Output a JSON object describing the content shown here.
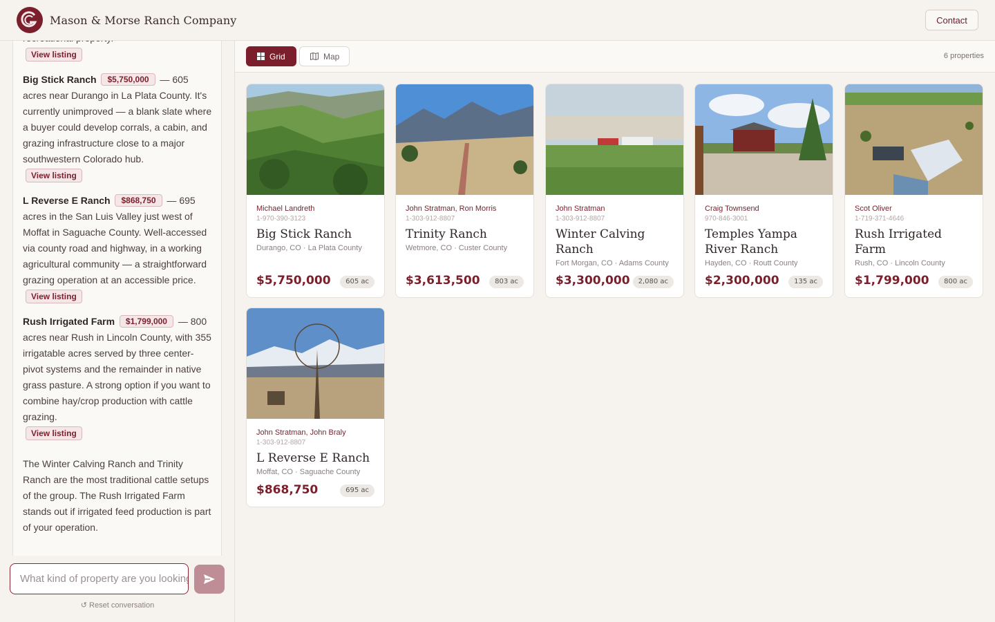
{
  "header": {
    "brand": "Mason & Morse Ranch Company",
    "contact_label": "Contact"
  },
  "chat": {
    "intro_tail": "recreational property.",
    "listings": [
      {
        "name": "Big Stick Ranch",
        "price": "$5,750,000",
        "text": " — 605 acres near Durango in La Plata County. It's currently unimproved — a blank slate where a buyer could develop corrals, a cabin, and grazing infrastructure close to a major southwestern Colorado hub."
      },
      {
        "name": "L Reverse E Ranch",
        "price": "$868,750",
        "text": " — 695 acres in the San Luis Valley just west of Moffat in Saguache County. Well-accessed via county road and highway, in a working agricultural community — a straightforward grazing operation at an accessible price."
      },
      {
        "name": "Rush Irrigated Farm",
        "price": "$1,799,000",
        "text": " — 800 acres near Rush in Lincoln County, with 355 irrigatable acres served by three center-pivot systems and the remainder in native grass pasture. A strong option if you want to combine hay/crop production with cattle grazing."
      }
    ],
    "view_listing_label": "View listing",
    "closing": "The Winter Calving Ranch and Trinity Ranch are the most traditional cattle setups of the group. The Rush Irrigated Farm stands out if irrigated feed production is part of your operation.",
    "input_placeholder": "What kind of property are you looking for?",
    "reset_label": "↺ Reset conversation"
  },
  "toolbar": {
    "grid_label": "Grid",
    "map_label": "Map",
    "count": "6 properties"
  },
  "properties": [
    {
      "agents": "Michael Landreth",
      "phone": "1-970-390-3123",
      "title": "Big Stick Ranch",
      "location": "Durango, CO · La Plata County",
      "price": "$5,750,000",
      "acres": "605 ac"
    },
    {
      "agents": "John Stratman, Ron Morris",
      "phone": "1-303-912-8807",
      "title": "Trinity Ranch",
      "location": "Wetmore, CO · Custer County",
      "price": "$3,613,500",
      "acres": "803 ac"
    },
    {
      "agents": "John Stratman",
      "phone": "1-303-912-8807",
      "title": "Winter Calving Ranch",
      "location": "Fort Morgan, CO · Adams County",
      "price": "$3,300,000",
      "acres": "2,080 ac"
    },
    {
      "agents": "Craig Townsend",
      "phone": "970-846-3001",
      "title": "Temples Yampa River Ranch",
      "location": "Hayden, CO · Routt County",
      "price": "$2,300,000",
      "acres": "135 ac"
    },
    {
      "agents": "Scot Oliver",
      "phone": "1-719-371-4646",
      "title": "Rush Irrigated Farm",
      "location": "Rush, CO · Lincoln County",
      "price": "$1,799,000",
      "acres": "800 ac"
    },
    {
      "agents": "John Stratman, John Braly",
      "phone": "1-303-912-8807",
      "title": "L Reverse E Ranch",
      "location": "Moffat, CO · Saguache County",
      "price": "$868,750",
      "acres": "695 ac"
    }
  ],
  "colors": {
    "brand": "#7a1f2b",
    "background": "#f6f3ef"
  }
}
